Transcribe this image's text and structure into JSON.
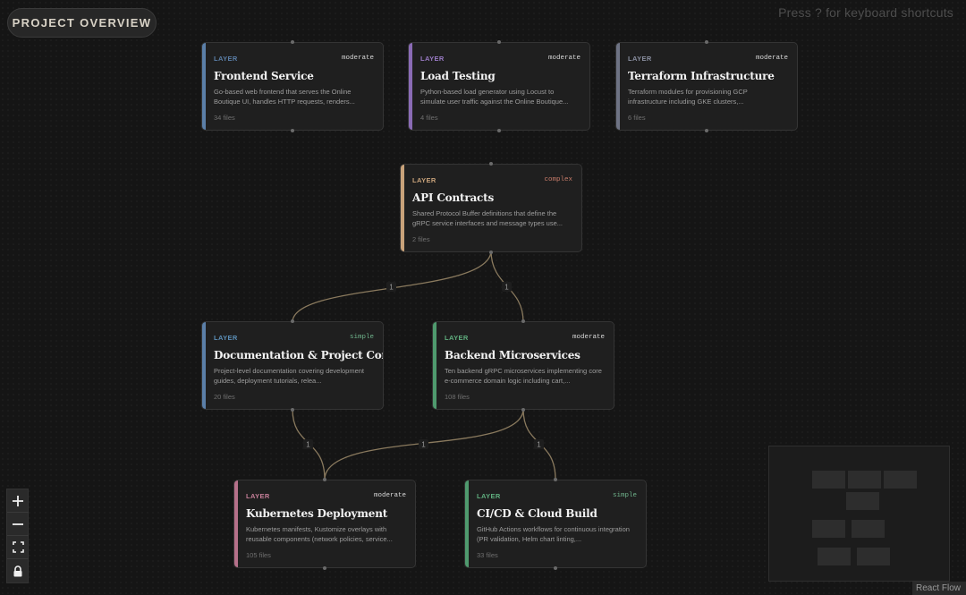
{
  "header": {
    "overview_button": "PROJECT OVERVIEW",
    "shortcut_hint": "Press ? for keyboard shortcuts"
  },
  "colors": {
    "background": "#151515",
    "node_background": "#1f1f1f",
    "edge": "#8a7a5e",
    "accent_blue": "#5b7fa8",
    "accent_purple": "#8a6bb5",
    "accent_gray": "#6e7384",
    "accent_tan": "#c8a27a",
    "accent_green": "#4f9a6e",
    "accent_pink": "#b5708a",
    "complex_text": "#c77c6a",
    "simple_text": "#6fb38b"
  },
  "nodes": [
    {
      "id": "frontend",
      "layer": "LAYER",
      "complexity": "moderate",
      "title": "Frontend Service",
      "description": "Go-based web frontend that serves the Online Boutique UI, handles HTTP requests, renders...",
      "files": "34 files"
    },
    {
      "id": "load-testing",
      "layer": "LAYER",
      "complexity": "moderate",
      "title": "Load Testing",
      "description": "Python-based load generator using Locust to simulate user traffic against the Online Boutique...",
      "files": "4 files"
    },
    {
      "id": "terraform",
      "layer": "LAYER",
      "complexity": "moderate",
      "title": "Terraform Infrastructure",
      "description": "Terraform modules for provisioning GCP infrastructure including GKE clusters,...",
      "files": "6 files"
    },
    {
      "id": "api-contracts",
      "layer": "LAYER",
      "complexity": "complex",
      "title": "API Contracts",
      "description": "Shared Protocol Buffer definitions that define the gRPC service interfaces and message types use...",
      "files": "2 files"
    },
    {
      "id": "documentation",
      "layer": "LAYER",
      "complexity": "simple",
      "title": "Documentation & Project Config",
      "description": "Project-level documentation covering development guides, deployment tutorials, relea...",
      "files": "20 files"
    },
    {
      "id": "backend",
      "layer": "LAYER",
      "complexity": "moderate",
      "title": "Backend Microservices",
      "description": "Ten backend gRPC microservices implementing core e-commerce domain logic including cart,...",
      "files": "108 files"
    },
    {
      "id": "kubernetes",
      "layer": "LAYER",
      "complexity": "moderate",
      "title": "Kubernetes Deployment",
      "description": "Kubernetes manifests, Kustomize overlays with reusable components (network policies, service...",
      "files": "105 files"
    },
    {
      "id": "cicd",
      "layer": "LAYER",
      "complexity": "simple",
      "title": "CI/CD & Cloud Build",
      "description": "GitHub Actions workflows for continuous integration (PR validation, Helm chart linting,...",
      "files": "33 files"
    }
  ],
  "edges": [
    {
      "from": "api-contracts",
      "to": "documentation",
      "label": "1"
    },
    {
      "from": "api-contracts",
      "to": "backend",
      "label": "1"
    },
    {
      "from": "documentation",
      "to": "kubernetes",
      "label": "1"
    },
    {
      "from": "backend",
      "to": "kubernetes",
      "label": "1"
    },
    {
      "from": "backend",
      "to": "cicd",
      "label": "1"
    }
  ],
  "controls": {
    "zoom_in": "plus-icon",
    "zoom_out": "minus-icon",
    "fit_view": "fit-view-icon",
    "lock": "lock-icon"
  },
  "attribution": "React Flow"
}
